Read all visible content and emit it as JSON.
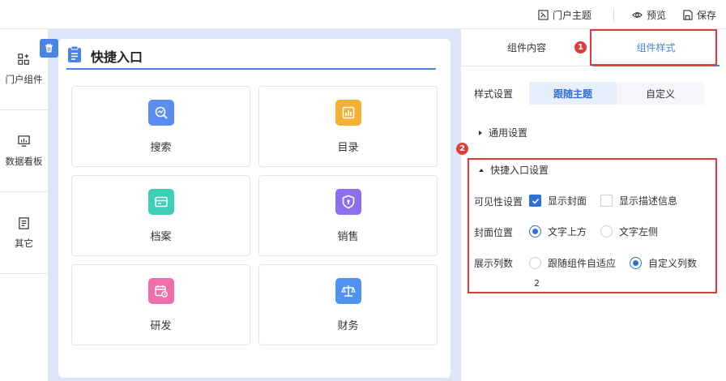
{
  "topbar": {
    "theme_label": "门户主题",
    "preview_label": "预览",
    "save_label": "保存"
  },
  "leftnav": {
    "items": [
      {
        "label": "门户组件",
        "icon": "components-icon"
      },
      {
        "label": "数据看板",
        "icon": "dashboard-icon"
      },
      {
        "label": "其它",
        "icon": "document-icon"
      }
    ]
  },
  "card": {
    "title": "快捷入口",
    "tiles": [
      {
        "label": "搜索",
        "icon": "search-chart-icon",
        "color": "#5b8def"
      },
      {
        "label": "目录",
        "icon": "bar-chart-icon",
        "color": "#f2b134"
      },
      {
        "label": "档案",
        "icon": "archive-card-icon",
        "color": "#3ccfb5"
      },
      {
        "label": "销售",
        "icon": "shield-icon",
        "color": "#8a6ff0"
      },
      {
        "label": "研发",
        "icon": "calendar-clock-icon",
        "color": "#f06faa"
      },
      {
        "label": "财务",
        "icon": "balance-scale-icon",
        "color": "#4f92ef"
      }
    ]
  },
  "panel": {
    "tabs": [
      "组件内容",
      "组件样式"
    ],
    "active_tab": "组件样式",
    "badges": [
      "1",
      "2"
    ],
    "style_setting_label": "样式设置",
    "style_options": [
      "跟随主题",
      "自定义"
    ],
    "style_selected": "跟随主题",
    "general_section": "通用设置",
    "quick_section": "快捷入口设置",
    "visibility": {
      "label": "可见性设置",
      "show_cover": {
        "label": "显示封面",
        "checked": true
      },
      "show_desc": {
        "label": "显示描述信息",
        "checked": false
      }
    },
    "cover_position": {
      "label": "封面位置",
      "options": [
        "文字上方",
        "文字左侧"
      ],
      "selected": "文字上方"
    },
    "columns": {
      "label": "展示列数",
      "options": [
        "跟随组件自适应",
        "自定义列数"
      ],
      "selected": "自定义列数",
      "value": "2"
    }
  },
  "colors": {
    "accent": "#4b83e5",
    "highlight_red": "#e03a3a",
    "canvas_bg": "#dbe6f6"
  }
}
